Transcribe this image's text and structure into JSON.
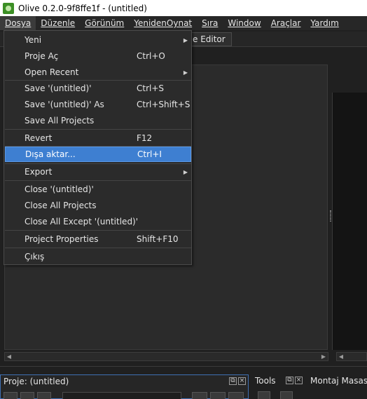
{
  "window": {
    "title": "Olive 0.2.0-9f8ffe1f - (untitled)"
  },
  "menubar": [
    {
      "label": "Dosya"
    },
    {
      "label": "Düzenle"
    },
    {
      "label": "Görünüm"
    },
    {
      "label": "YenidenOynat"
    },
    {
      "label": "Sıra"
    },
    {
      "label": "Window"
    },
    {
      "label": "Araçlar"
    },
    {
      "label": "Yardım"
    }
  ],
  "background": {
    "editor_tab": "e Editor"
  },
  "file_menu": {
    "items": [
      {
        "label": "Yeni",
        "shortcut": "",
        "submenu": true
      },
      {
        "label": "Proje Aç",
        "shortcut": "Ctrl+O",
        "submenu": false
      },
      {
        "label": "Open Recent",
        "shortcut": "",
        "submenu": true
      },
      {
        "label": "Save '(untitled)'",
        "shortcut": "Ctrl+S",
        "submenu": false
      },
      {
        "label": "Save '(untitled)' As",
        "shortcut": "Ctrl+Shift+S",
        "submenu": false
      },
      {
        "label": "Save All Projects",
        "shortcut": "",
        "submenu": false
      },
      {
        "label": "Revert",
        "shortcut": "F12",
        "submenu": false
      },
      {
        "label": "Dışa aktar...",
        "shortcut": "Ctrl+I",
        "submenu": false
      },
      {
        "label": "Export",
        "shortcut": "",
        "submenu": true
      },
      {
        "label": "Close '(untitled)'",
        "shortcut": "",
        "submenu": false
      },
      {
        "label": "Close All Projects",
        "shortcut": "",
        "submenu": false
      },
      {
        "label": "Close All Except '(untitled)'",
        "shortcut": "",
        "submenu": false
      },
      {
        "label": "Project Properties",
        "shortcut": "Shift+F10",
        "submenu": false
      },
      {
        "label": "Çıkış",
        "shortcut": "",
        "submenu": false
      }
    ]
  },
  "panels": {
    "proje": {
      "title": "Proje: (untitled)"
    },
    "tools": {
      "title": "Tools"
    },
    "montaj": {
      "title": "Montaj Masası:"
    }
  },
  "colors": {
    "highlight": "#3e7fd1",
    "menu_bg": "#2b2b2b",
    "accent_border": "#3f6fb3"
  },
  "icons": [
    "olive-app-icon",
    "chevron-right-icon",
    "float-panel-icon",
    "close-panel-icon"
  ]
}
